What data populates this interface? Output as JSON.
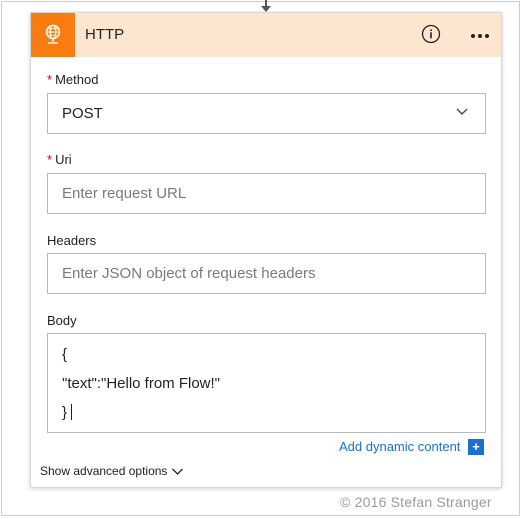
{
  "connector": {
    "icon": "down-arrow-icon"
  },
  "action": {
    "title": "HTTP",
    "icon": "globe-icon",
    "accent_color": "#f97c10",
    "header_bg": "#fde6cf",
    "info_icon": "info-icon",
    "menu_icon": "more-options-icon"
  },
  "method": {
    "label": "Method",
    "required_mark": "*",
    "value": "POST",
    "dropdown_icon": "chevron-down-icon"
  },
  "uri": {
    "label": "Uri",
    "required_mark": "*",
    "value": "",
    "placeholder": "Enter request URL"
  },
  "headers": {
    "label": "Headers",
    "value": "",
    "placeholder": "Enter JSON object of request headers"
  },
  "body": {
    "label": "Body",
    "lines": [
      "{",
      "\"text\":\"Hello from Flow!\"",
      "}"
    ]
  },
  "dynamic_content": {
    "label": "Add dynamic content",
    "plus_symbol": "+",
    "color": "#1a6fd0"
  },
  "advanced": {
    "label": "Show advanced options"
  },
  "watermark": {
    "text": "© 2016 Stefan Stranger"
  }
}
